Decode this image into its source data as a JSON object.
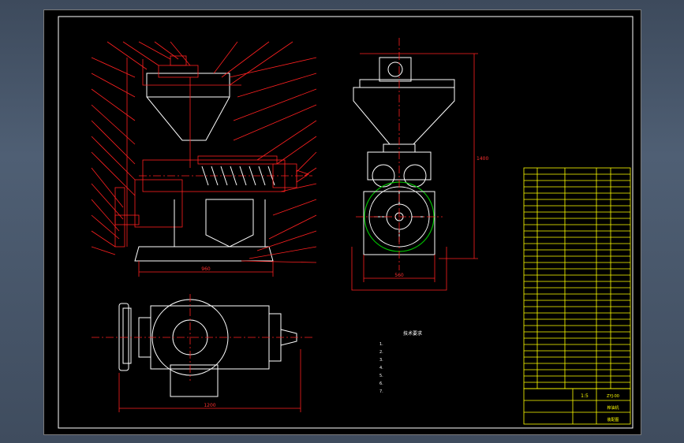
{
  "drawing": {
    "colors": {
      "background": "#000000",
      "outline": "#ffffff",
      "dimension": "#ff2020",
      "table": "#ffff00",
      "flywheel": "#00c000"
    },
    "front_view": {
      "overall_width_label": "960"
    },
    "side_view": {
      "overall_height_label": "1400",
      "base_width_label": "560"
    },
    "top_view": {
      "overall_width_label": "1200"
    },
    "notes": {
      "heading": "技术要求",
      "lines": [
        "1.",
        "2.",
        "3.",
        "4.",
        "5.",
        "6.",
        "7."
      ]
    },
    "title_block": {
      "drawing_name": "榨油机",
      "sheet_label": "装配图",
      "scale": "1:5",
      "code": "ZYJ-00"
    },
    "parts_list": {
      "rows": 35
    }
  }
}
